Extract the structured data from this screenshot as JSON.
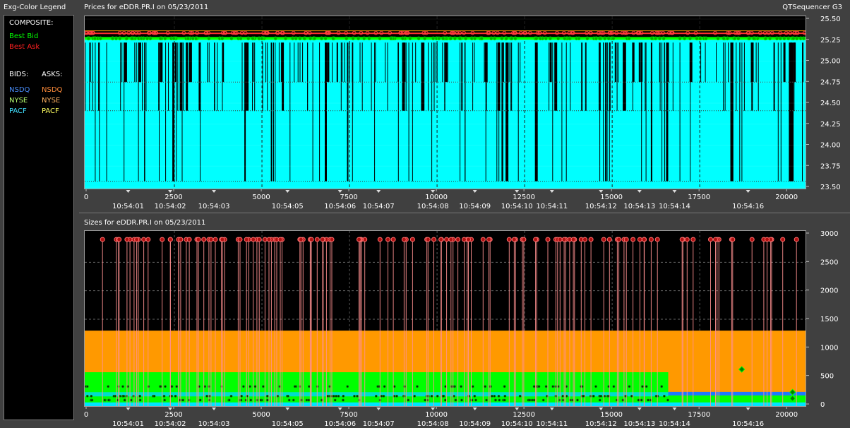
{
  "legend": {
    "title": "Exg-Color Legend",
    "composite_label": "COMPOSITE:",
    "best_bid": "Best Bid",
    "best_ask": "Best Ask",
    "bids_label": "BIDS:",
    "asks_label": "ASKS:",
    "bids": [
      "NSDQ",
      "NYSE",
      "PACF"
    ],
    "asks": [
      "NSDQ",
      "NYSE",
      "PACF"
    ],
    "colors": {
      "best_bid": "#00ff00",
      "best_ask": "#ff2020",
      "bid_nsdq": "#4a90ff",
      "bid_nyse": "#b8ff70",
      "bid_pacf": "#40e0ff",
      "ask_nsdq": "#ff8c3a",
      "ask_nyse": "#ffb060",
      "ask_pacf": "#ffff60"
    }
  },
  "app_title": "QTSequencer G3",
  "prices_title": "Prices for  eDDR.PR.I  on  05/23/2011",
  "sizes_title": "Sizes for  eDDR.PR.I  on  05/23/2011",
  "x_ticks": [
    "0",
    "2500",
    "5000",
    "7500",
    "10000",
    "12500",
    "15000",
    "17500",
    "20000"
  ],
  "x_tick_values": [
    0,
    2500,
    5000,
    7500,
    10000,
    12500,
    15000,
    17500,
    20000
  ],
  "time_labels": [
    {
      "t": "10:54:01",
      "x": 1200
    },
    {
      "t": "10:54:02",
      "x": 2400
    },
    {
      "t": "10:54:03",
      "x": 3650
    },
    {
      "t": "10:54:05",
      "x": 5750
    },
    {
      "t": "10:54:06",
      "x": 7250
    },
    {
      "t": "10:54:07",
      "x": 8350
    },
    {
      "t": "10:54:08",
      "x": 9900
    },
    {
      "t": "10:54:09",
      "x": 11100
    },
    {
      "t": "10:54:10",
      "x": 12300
    },
    {
      "t": "10:54:11",
      "x": 13300
    },
    {
      "t": "10:54:12",
      "x": 14700
    },
    {
      "t": "10:54:13",
      "x": 15800
    },
    {
      "t": "10:54:14",
      "x": 16800
    },
    {
      "t": "10:54:16",
      "x": 18900
    }
  ],
  "chart_data": [
    {
      "type": "line",
      "title": "Prices for  eDDR.PR.I  on  05/23/2011",
      "xlim": [
        0,
        20500
      ],
      "ylim": [
        23.5,
        25.5
      ],
      "y_ticks": [
        "25.50",
        "25.25",
        "25.00",
        "24.75",
        "24.50",
        "24.25",
        "24.00",
        "23.75",
        "23.50"
      ],
      "y_tick_values": [
        25.5,
        25.25,
        25.0,
        24.75,
        24.5,
        24.25,
        24.0,
        23.75,
        23.5
      ],
      "series": [
        {
          "name": "Best Ask",
          "level": 25.33
        },
        {
          "name": "Best Bid",
          "level": 25.27
        }
      ],
      "bid_floor_levels": [
        24.75,
        24.41,
        23.57
      ],
      "grid_x": [
        0,
        2500,
        5000,
        7500,
        10000,
        12500,
        15000,
        17500
      ]
    },
    {
      "type": "area",
      "title": "Sizes for  eDDR.PR.I  on  05/23/2011",
      "xlim": [
        0,
        20500
      ],
      "ylim": [
        0,
        3000
      ],
      "y_ticks": [
        "3000",
        "2500",
        "2000",
        "1500",
        "1000",
        "500",
        "0"
      ],
      "y_tick_values": [
        3000,
        2500,
        2000,
        1500,
        1000,
        500,
        0
      ],
      "ask_size_level": 1300,
      "bid_size_level": 570,
      "bid_size_level_after": 200,
      "bid_size_step_x": 16600,
      "ask_spike_level": 2900,
      "grid_y": [
        2500,
        2000,
        1500
      ]
    }
  ]
}
